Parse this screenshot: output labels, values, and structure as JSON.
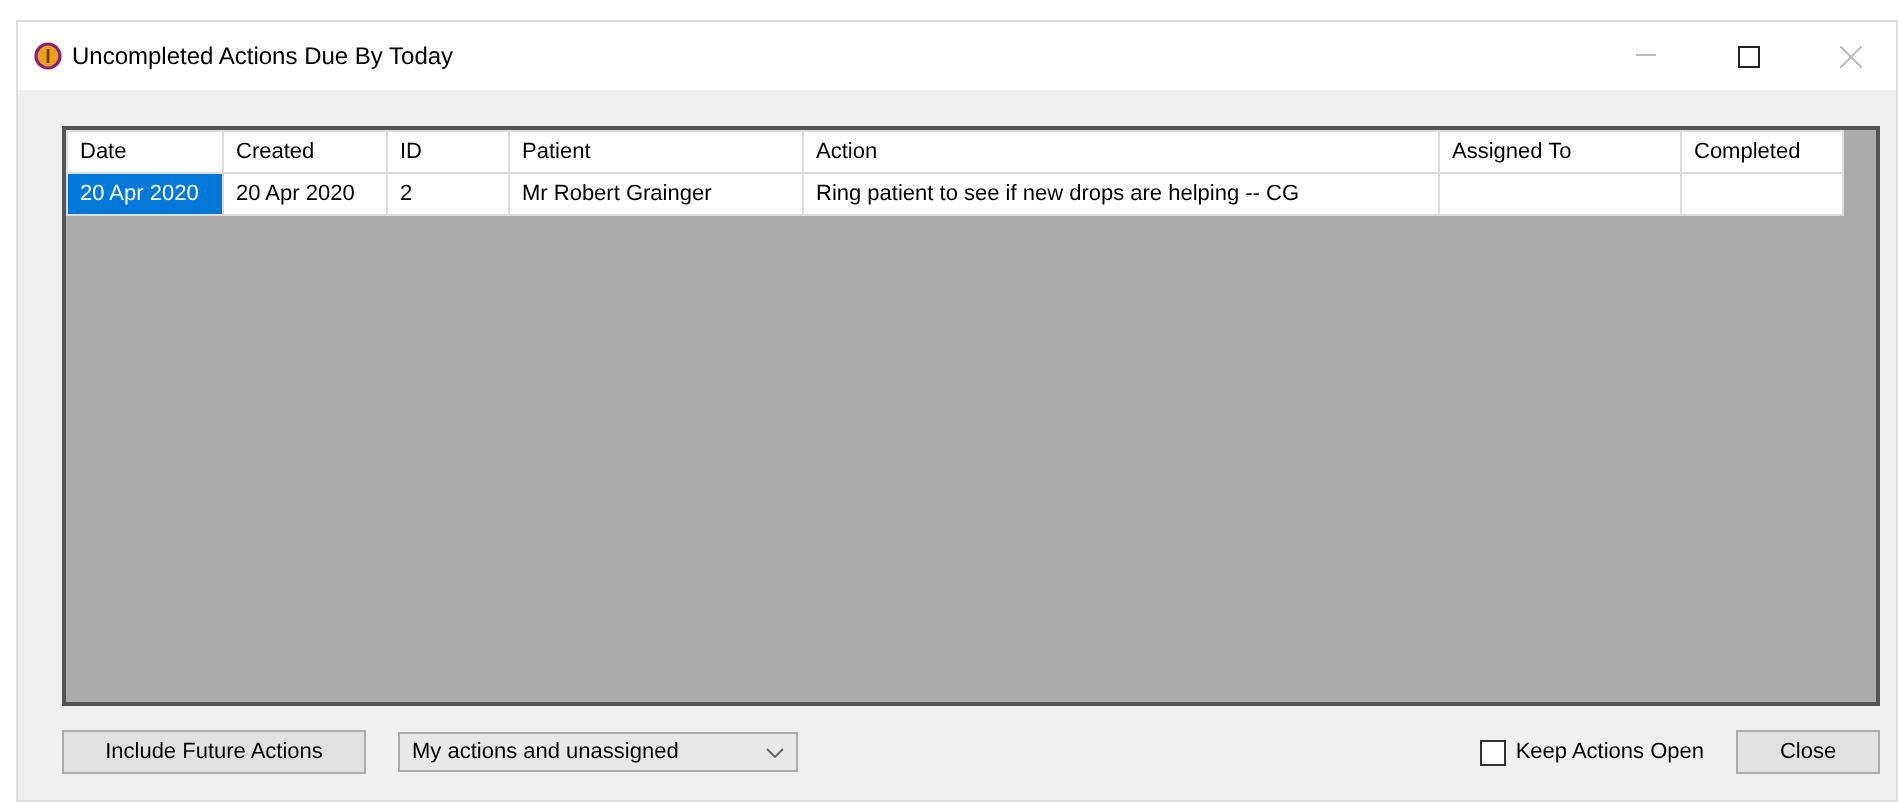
{
  "window": {
    "title": "Uncompleted Actions Due By Today"
  },
  "table": {
    "columns": [
      "Date",
      "Created",
      "ID",
      "Patient",
      "Action",
      "Assigned To",
      "Completed"
    ],
    "rows": [
      {
        "cells": [
          {
            "text": "20 Apr 2020",
            "selected": true
          },
          {
            "text": "20 Apr 2020",
            "selected": false
          },
          {
            "text": "2",
            "selected": false
          },
          {
            "text": "Mr Robert Grainger",
            "selected": false
          },
          {
            "text": "Ring patient to see if new drops are helping -- CG",
            "selected": false
          },
          {
            "selected": false
          },
          {
            "selected": false
          }
        ]
      }
    ]
  },
  "footer": {
    "future_button": "Include Future Actions",
    "filter": {
      "value": "My actions and unassigned"
    },
    "keep_open": {
      "label": "Keep Actions Open",
      "checked": false
    },
    "close_button": "Close"
  }
}
